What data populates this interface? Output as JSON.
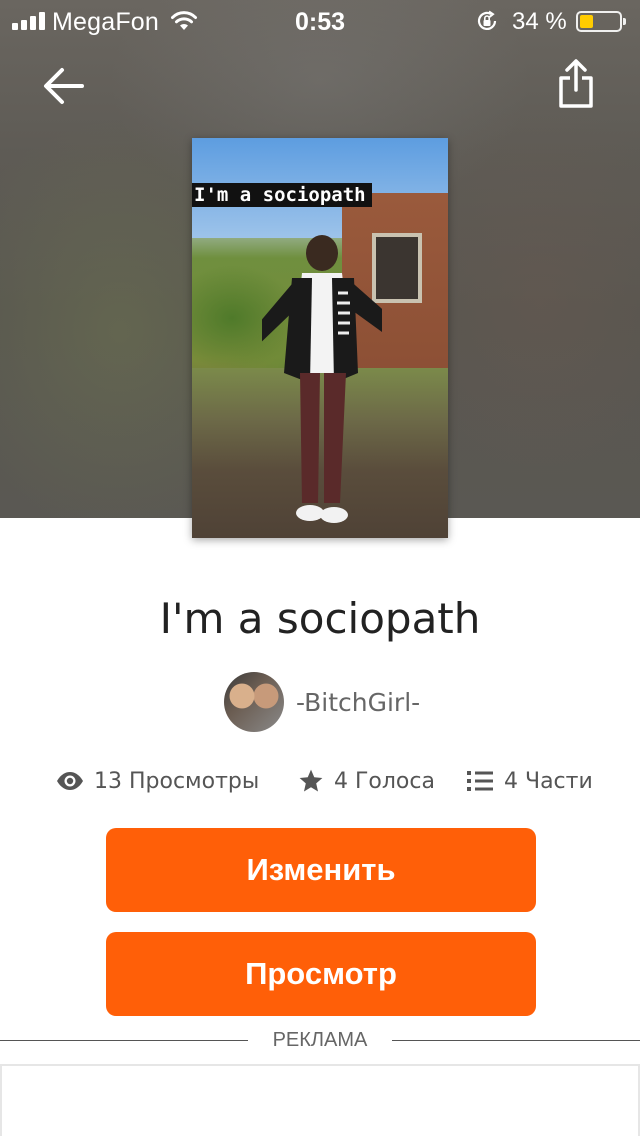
{
  "status_bar": {
    "carrier": "MegaFon",
    "time": "0:53",
    "battery_percent": "34 %",
    "battery_level": 0.34,
    "battery_color": "#ffcc00"
  },
  "header": {
    "back_icon": "arrow-left-icon",
    "share_icon": "share-icon"
  },
  "story": {
    "cover_text": "I'm a sociopath",
    "title": "I'm a sociopath",
    "author": "-BitchGirl-",
    "stats": {
      "views": "13 Просмотры",
      "votes": "4 Голоса",
      "parts": "4 Части"
    }
  },
  "actions": {
    "edit_label": "Изменить",
    "preview_label": "Просмотр"
  },
  "ad": {
    "label": "РЕКЛАМА"
  },
  "colors": {
    "accent": "#ff5f08",
    "text": "#222222",
    "muted": "#666666"
  }
}
